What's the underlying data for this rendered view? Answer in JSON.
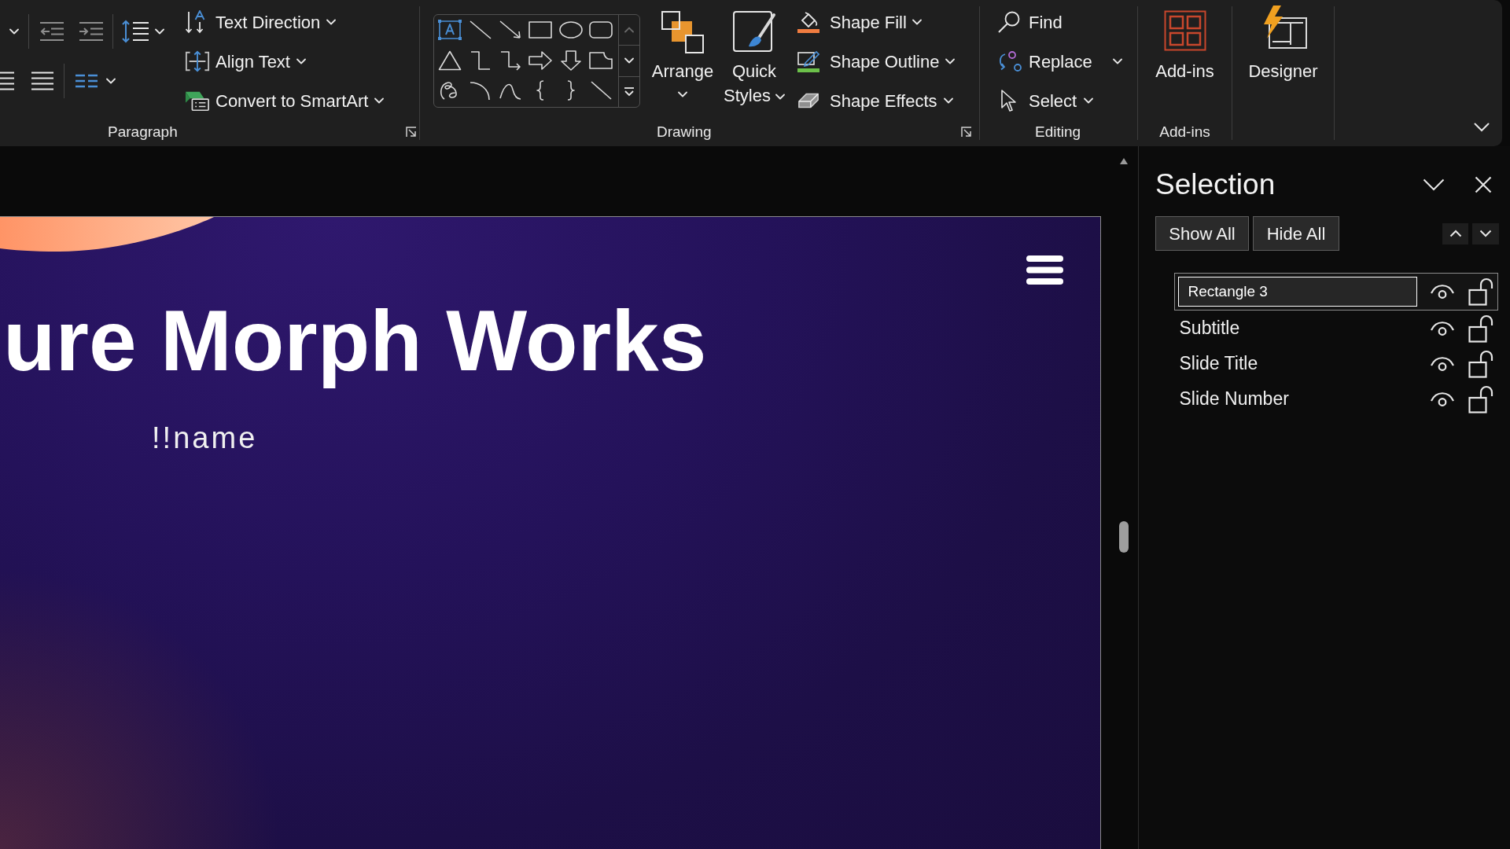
{
  "ribbon": {
    "groups": [
      {
        "kind": "paragraph",
        "label": "Paragraph",
        "launcher": true,
        "commands": [
          {
            "label": "Text Direction",
            "dropdown": true
          },
          {
            "label": "Align Text",
            "dropdown": true
          },
          {
            "label": "Convert to SmartArt",
            "dropdown": true
          }
        ]
      },
      {
        "kind": "drawing",
        "label": "Drawing",
        "launcher": true,
        "large_buttons": [
          {
            "label": "Arrange",
            "dropdown": true
          },
          {
            "label": "Quick Styles",
            "dropdown": true
          }
        ],
        "commands": [
          {
            "label": "Shape Fill",
            "dropdown": true
          },
          {
            "label": "Shape Outline",
            "dropdown": true
          },
          {
            "label": "Shape Effects",
            "dropdown": true
          }
        ]
      },
      {
        "kind": "editing",
        "label": "Editing",
        "commands": [
          {
            "label": "Find",
            "dropdown": false
          },
          {
            "label": "Replace",
            "dropdown": true
          },
          {
            "label": "Select",
            "dropdown": true
          }
        ]
      },
      {
        "kind": "addins",
        "label": "Add-ins",
        "large_buttons": [
          {
            "label": "Add-ins",
            "dropdown": false
          }
        ]
      },
      {
        "kind": "designer",
        "large_buttons": [
          {
            "label": "Designer",
            "dropdown": false
          }
        ]
      }
    ]
  },
  "slide": {
    "title": "ure Morph Works",
    "subtitle": "!!name"
  },
  "selection_pane": {
    "title": "Selection",
    "buttons": [
      "Show All",
      "Hide All"
    ],
    "items": [
      {
        "name": "Rectangle 3",
        "selected": true,
        "editing": true,
        "visible": true,
        "locked": false
      },
      {
        "name": "Subtitle",
        "selected": false,
        "editing": false,
        "visible": true,
        "locked": false
      },
      {
        "name": "Slide Title",
        "selected": false,
        "editing": false,
        "visible": true,
        "locked": false
      },
      {
        "name": "Slide Number",
        "selected": false,
        "editing": false,
        "visible": true,
        "locked": false
      }
    ]
  }
}
